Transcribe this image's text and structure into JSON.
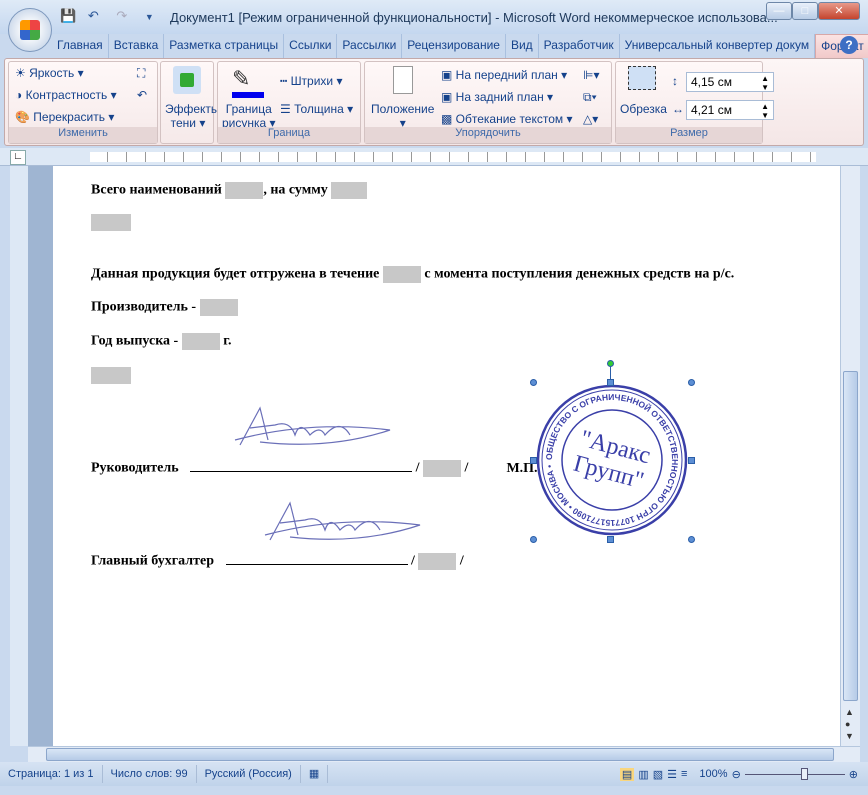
{
  "title": "Документ1 [Режим ограниченной функциональности] - Microsoft Word некоммерческое использова...",
  "tabs": [
    "Главная",
    "Вставка",
    "Разметка страницы",
    "Ссылки",
    "Рассылки",
    "Рецензирование",
    "Вид",
    "Разработчик",
    "Универсальный конвертер докум",
    "Формат"
  ],
  "ribbon": {
    "adjust": {
      "brightness": "Яркость",
      "contrast": "Контрастность",
      "recolor": "Перекрасить",
      "label": "Изменить"
    },
    "shadow": {
      "effects1": "Эффекты",
      "effects2": "тени"
    },
    "border": {
      "border1": "Граница",
      "border2": "рисунка",
      "dashes": "Штрихи",
      "weight": "Толщина",
      "label": "Граница"
    },
    "arrange": {
      "position": "Положение",
      "front": "На передний план",
      "back": "На задний план",
      "wrap": "Обтекание текстом",
      "label": "Упорядочить"
    },
    "size": {
      "crop": "Обрезка",
      "height": "4,15 см",
      "width": "4,21 см",
      "label": "Размер"
    }
  },
  "doc": {
    "l1a": "Всего наименований",
    "l1b": ", на сумму",
    "l2a": "Данная продукция будет отгружена в течение",
    "l2b": "с момента поступления денежных средств на р/с.",
    "l3": "Производитель -",
    "l4a": "Год выпуска -",
    "l4b": "г.",
    "head": "Руководитель",
    "slash": "/",
    "mp": "М.П.",
    "acc": "Главный бухгалтер",
    "stamp": {
      "center1": "\"Аракс",
      "center2": "Групп\"",
      "ring": "ОБЩЕСТВО С ОГРАНИЧЕННОЙ ОТВЕТСТВЕННОСТЬЮ ОГРН 1077151771090 • МОСКВА •",
      "color": "#3a3fa8"
    }
  },
  "status": {
    "page": "Страница: 1 из 1",
    "words": "Число слов: 99",
    "lang": "Русский (Россия)",
    "zoom": "100%"
  }
}
